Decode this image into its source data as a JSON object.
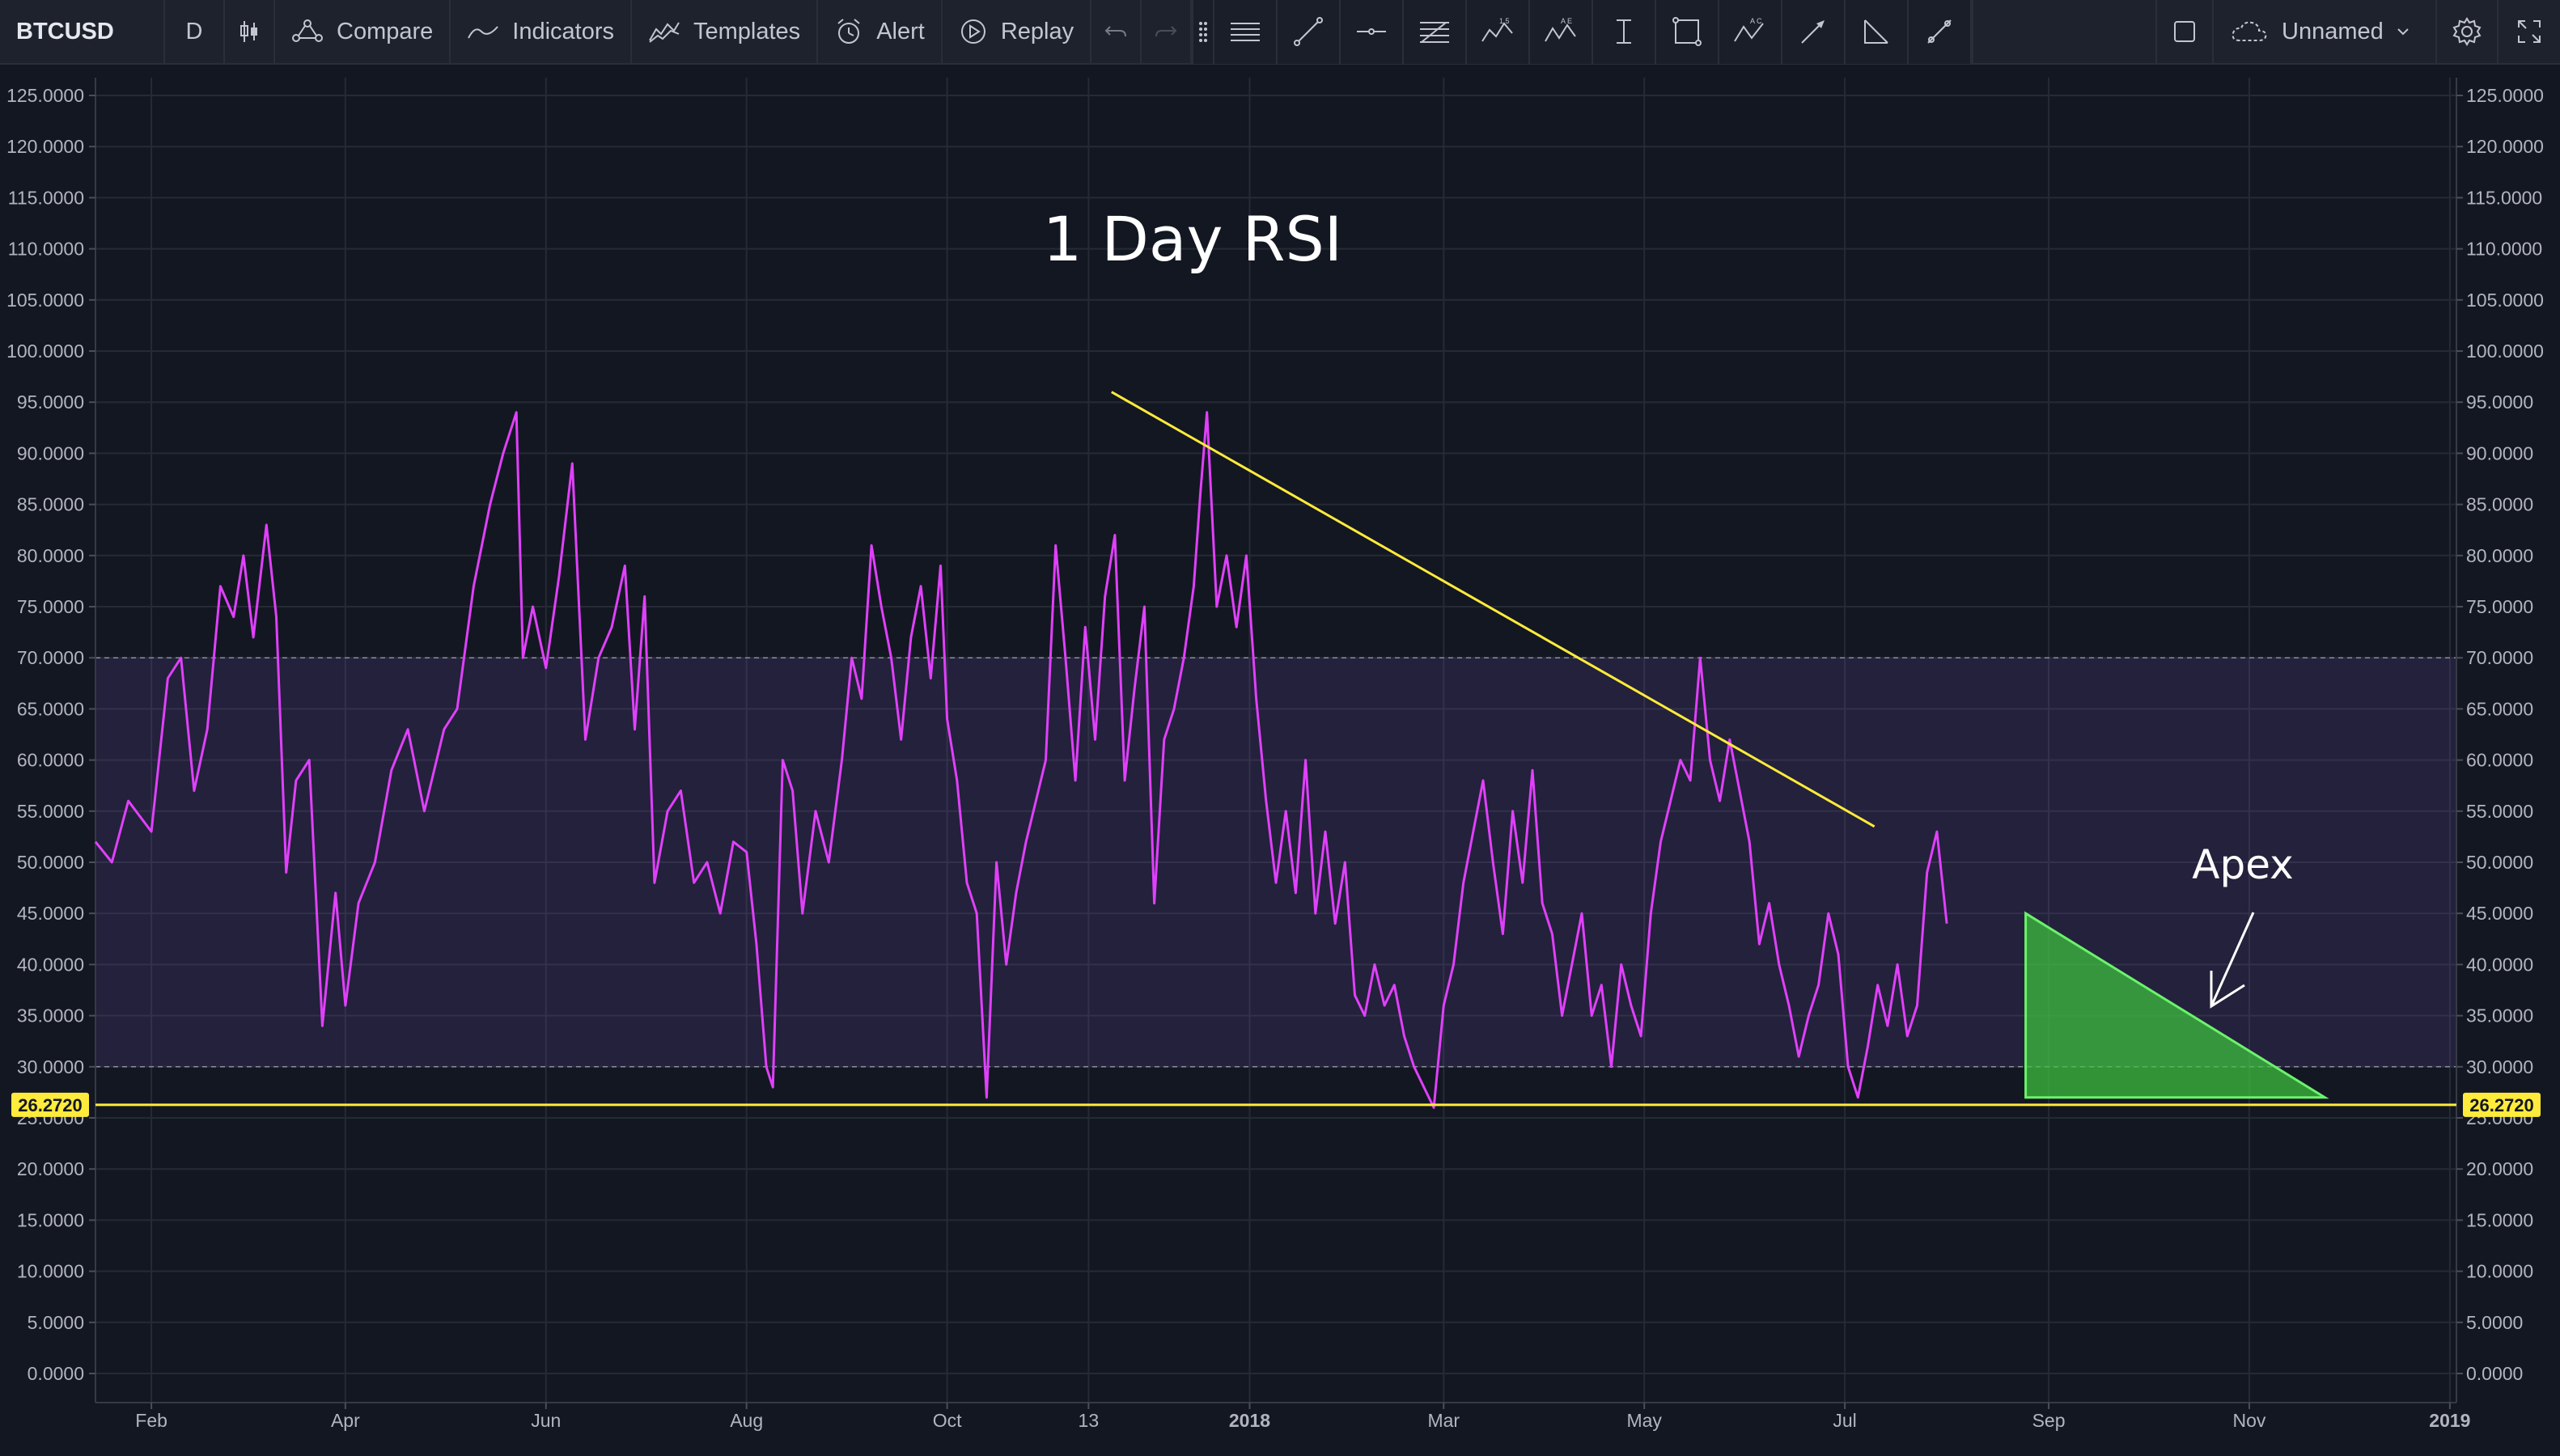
{
  "toolbar": {
    "symbol": "BTCUSD",
    "interval": "D",
    "compare_label": "Compare",
    "indicators_label": "Indicators",
    "templates_label": "Templates",
    "alert_label": "Alert",
    "replay_label": "Replay",
    "layout_name": "Unnamed"
  },
  "colors": {
    "background": "#131722",
    "grid": "#262a35",
    "rsi_line": "#e040fb",
    "rsi_band": "#7e57c2",
    "trendline": "#ffeb3b",
    "apex_fill": "#3ec43e",
    "apex_border": "#6cf26c"
  },
  "chart_data": {
    "type": "line",
    "title": "1 Day RSI",
    "annotation": "Apex",
    "ylim": [
      0,
      125
    ],
    "y_ticks": [
      "125.0000",
      "120.0000",
      "115.0000",
      "110.0000",
      "105.0000",
      "100.0000",
      "95.0000",
      "90.0000",
      "85.0000",
      "80.0000",
      "75.0000",
      "70.0000",
      "65.0000",
      "60.0000",
      "55.0000",
      "50.0000",
      "45.0000",
      "40.0000",
      "35.0000",
      "30.0000",
      "25.0000",
      "20.0000",
      "15.0000",
      "10.0000",
      "5.0000",
      "0.0000"
    ],
    "x_ticks": [
      {
        "label": "Feb",
        "date": "2017-02-01",
        "bold": false
      },
      {
        "label": "Apr",
        "date": "2017-04-01",
        "bold": false
      },
      {
        "label": "Jun",
        "date": "2017-06-01",
        "bold": false
      },
      {
        "label": "Aug",
        "date": "2017-08-01",
        "bold": false
      },
      {
        "label": "Oct",
        "date": "2017-10-01",
        "bold": false
      },
      {
        "label": "13",
        "date": "2017-11-13",
        "bold": false
      },
      {
        "label": "2018",
        "date": "2018-01-01",
        "bold": true
      },
      {
        "label": "Mar",
        "date": "2018-03-01",
        "bold": false
      },
      {
        "label": "May",
        "date": "2018-05-01",
        "bold": false
      },
      {
        "label": "Jul",
        "date": "2018-07-01",
        "bold": false
      },
      {
        "label": "Sep",
        "date": "2018-09-01",
        "bold": false
      },
      {
        "label": "Nov",
        "date": "2018-11-01",
        "bold": false
      },
      {
        "label": "2019",
        "date": "2019-01-01",
        "bold": true
      }
    ],
    "x_range": [
      "2017-01-15",
      "2019-01-03"
    ],
    "rsi_band": [
      30,
      70
    ],
    "support_level": 26.272,
    "support_label": "26.2720",
    "trendline": {
      "start": [
        "2017-11-20",
        96.0
      ],
      "end": [
        "2018-07-10",
        53.5
      ]
    },
    "apex_triangle": [
      [
        "2018-08-25",
        45.0
      ],
      [
        "2018-11-24",
        27.0
      ],
      [
        "2018-08-25",
        27.0
      ]
    ],
    "series": [
      {
        "points": [
          [
            "2017-01-15",
            52
          ],
          [
            "2017-01-20",
            50
          ],
          [
            "2017-01-25",
            56
          ],
          [
            "2017-02-01",
            53
          ],
          [
            "2017-02-06",
            68
          ],
          [
            "2017-02-10",
            70
          ],
          [
            "2017-02-14",
            57
          ],
          [
            "2017-02-18",
            63
          ],
          [
            "2017-02-22",
            77
          ],
          [
            "2017-02-26",
            74
          ],
          [
            "2017-03-01",
            80
          ],
          [
            "2017-03-04",
            72
          ],
          [
            "2017-03-08",
            83
          ],
          [
            "2017-03-11",
            74
          ],
          [
            "2017-03-14",
            49
          ],
          [
            "2017-03-17",
            58
          ],
          [
            "2017-03-21",
            60
          ],
          [
            "2017-03-25",
            34
          ],
          [
            "2017-03-29",
            47
          ],
          [
            "2017-04-01",
            36
          ],
          [
            "2017-04-05",
            46
          ],
          [
            "2017-04-10",
            50
          ],
          [
            "2017-04-15",
            59
          ],
          [
            "2017-04-20",
            63
          ],
          [
            "2017-04-25",
            55
          ],
          [
            "2017-05-01",
            63
          ],
          [
            "2017-05-05",
            65
          ],
          [
            "2017-05-10",
            77
          ],
          [
            "2017-05-15",
            85
          ],
          [
            "2017-05-19",
            90
          ],
          [
            "2017-05-23",
            94
          ],
          [
            "2017-05-25",
            70
          ],
          [
            "2017-05-28",
            75
          ],
          [
            "2017-06-01",
            69
          ],
          [
            "2017-06-05",
            78
          ],
          [
            "2017-06-09",
            89
          ],
          [
            "2017-06-13",
            62
          ],
          [
            "2017-06-17",
            70
          ],
          [
            "2017-06-21",
            73
          ],
          [
            "2017-06-25",
            79
          ],
          [
            "2017-06-28",
            63
          ],
          [
            "2017-07-01",
            76
          ],
          [
            "2017-07-04",
            48
          ],
          [
            "2017-07-08",
            55
          ],
          [
            "2017-07-12",
            57
          ],
          [
            "2017-07-16",
            48
          ],
          [
            "2017-07-20",
            50
          ],
          [
            "2017-07-24",
            45
          ],
          [
            "2017-07-28",
            52
          ],
          [
            "2017-08-01",
            51
          ],
          [
            "2017-08-04",
            42
          ],
          [
            "2017-08-07",
            30
          ],
          [
            "2017-08-09",
            28
          ],
          [
            "2017-08-12",
            60
          ],
          [
            "2017-08-15",
            57
          ],
          [
            "2017-08-18",
            45
          ],
          [
            "2017-08-22",
            55
          ],
          [
            "2017-08-26",
            50
          ],
          [
            "2017-08-30",
            60
          ],
          [
            "2017-09-02",
            70
          ],
          [
            "2017-09-05",
            66
          ],
          [
            "2017-09-08",
            81
          ],
          [
            "2017-09-11",
            75
          ],
          [
            "2017-09-14",
            70
          ],
          [
            "2017-09-17",
            62
          ],
          [
            "2017-09-20",
            72
          ],
          [
            "2017-09-23",
            77
          ],
          [
            "2017-09-26",
            68
          ],
          [
            "2017-09-29",
            79
          ],
          [
            "2017-10-01",
            64
          ],
          [
            "2017-10-04",
            58
          ],
          [
            "2017-10-07",
            48
          ],
          [
            "2017-10-10",
            45
          ],
          [
            "2017-10-13",
            27
          ],
          [
            "2017-10-16",
            50
          ],
          [
            "2017-10-19",
            40
          ],
          [
            "2017-10-22",
            47
          ],
          [
            "2017-10-25",
            52
          ],
          [
            "2017-10-28",
            56
          ],
          [
            "2017-10-31",
            60
          ],
          [
            "2017-11-03",
            81
          ],
          [
            "2017-11-06",
            70
          ],
          [
            "2017-11-09",
            58
          ],
          [
            "2017-11-12",
            73
          ],
          [
            "2017-11-15",
            62
          ],
          [
            "2017-11-18",
            76
          ],
          [
            "2017-11-21",
            82
          ],
          [
            "2017-11-24",
            58
          ],
          [
            "2017-11-27",
            67
          ],
          [
            "2017-11-30",
            75
          ],
          [
            "2017-12-03",
            46
          ],
          [
            "2017-12-06",
            62
          ],
          [
            "2017-12-09",
            65
          ],
          [
            "2017-12-12",
            70
          ],
          [
            "2017-12-15",
            77
          ],
          [
            "2017-12-17",
            86
          ],
          [
            "2017-12-19",
            94
          ],
          [
            "2017-12-22",
            75
          ],
          [
            "2017-12-25",
            80
          ],
          [
            "2017-12-28",
            73
          ],
          [
            "2017-12-31",
            80
          ],
          [
            "2018-01-03",
            66
          ],
          [
            "2018-01-06",
            56
          ],
          [
            "2018-01-09",
            48
          ],
          [
            "2018-01-12",
            55
          ],
          [
            "2018-01-15",
            47
          ],
          [
            "2018-01-18",
            60
          ],
          [
            "2018-01-21",
            45
          ],
          [
            "2018-01-24",
            53
          ],
          [
            "2018-01-27",
            44
          ],
          [
            "2018-01-30",
            50
          ],
          [
            "2018-02-02",
            37
          ],
          [
            "2018-02-05",
            35
          ],
          [
            "2018-02-08",
            40
          ],
          [
            "2018-02-11",
            36
          ],
          [
            "2018-02-14",
            38
          ],
          [
            "2018-02-17",
            33
          ],
          [
            "2018-02-20",
            30
          ],
          [
            "2018-02-23",
            28
          ],
          [
            "2018-02-26",
            26
          ],
          [
            "2018-03-01",
            36
          ],
          [
            "2018-03-04",
            40
          ],
          [
            "2018-03-07",
            48
          ],
          [
            "2018-03-10",
            53
          ],
          [
            "2018-03-13",
            58
          ],
          [
            "2018-03-16",
            50
          ],
          [
            "2018-03-19",
            43
          ],
          [
            "2018-03-22",
            55
          ],
          [
            "2018-03-25",
            48
          ],
          [
            "2018-03-28",
            59
          ],
          [
            "2018-03-31",
            46
          ],
          [
            "2018-04-03",
            43
          ],
          [
            "2018-04-06",
            35
          ],
          [
            "2018-04-09",
            40
          ],
          [
            "2018-04-12",
            45
          ],
          [
            "2018-04-15",
            35
          ],
          [
            "2018-04-18",
            38
          ],
          [
            "2018-04-21",
            30
          ],
          [
            "2018-04-24",
            40
          ],
          [
            "2018-04-27",
            36
          ],
          [
            "2018-04-30",
            33
          ],
          [
            "2018-05-03",
            45
          ],
          [
            "2018-05-06",
            52
          ],
          [
            "2018-05-09",
            56
          ],
          [
            "2018-05-12",
            60
          ],
          [
            "2018-05-15",
            58
          ],
          [
            "2018-05-18",
            70
          ],
          [
            "2018-05-21",
            60
          ],
          [
            "2018-05-24",
            56
          ],
          [
            "2018-05-27",
            62
          ],
          [
            "2018-05-30",
            57
          ],
          [
            "2018-06-02",
            52
          ],
          [
            "2018-06-05",
            42
          ],
          [
            "2018-06-08",
            46
          ],
          [
            "2018-06-11",
            40
          ],
          [
            "2018-06-14",
            36
          ],
          [
            "2018-06-17",
            31
          ],
          [
            "2018-06-20",
            35
          ],
          [
            "2018-06-23",
            38
          ],
          [
            "2018-06-26",
            45
          ],
          [
            "2018-06-29",
            41
          ],
          [
            "2018-07-02",
            30
          ],
          [
            "2018-07-05",
            27
          ],
          [
            "2018-07-08",
            32
          ],
          [
            "2018-07-11",
            38
          ],
          [
            "2018-07-14",
            34
          ],
          [
            "2018-07-17",
            40
          ],
          [
            "2018-07-20",
            33
          ],
          [
            "2018-07-23",
            36
          ],
          [
            "2018-07-26",
            49
          ],
          [
            "2018-07-29",
            53
          ],
          [
            "2018-08-01",
            44
          ]
        ]
      }
    ]
  }
}
